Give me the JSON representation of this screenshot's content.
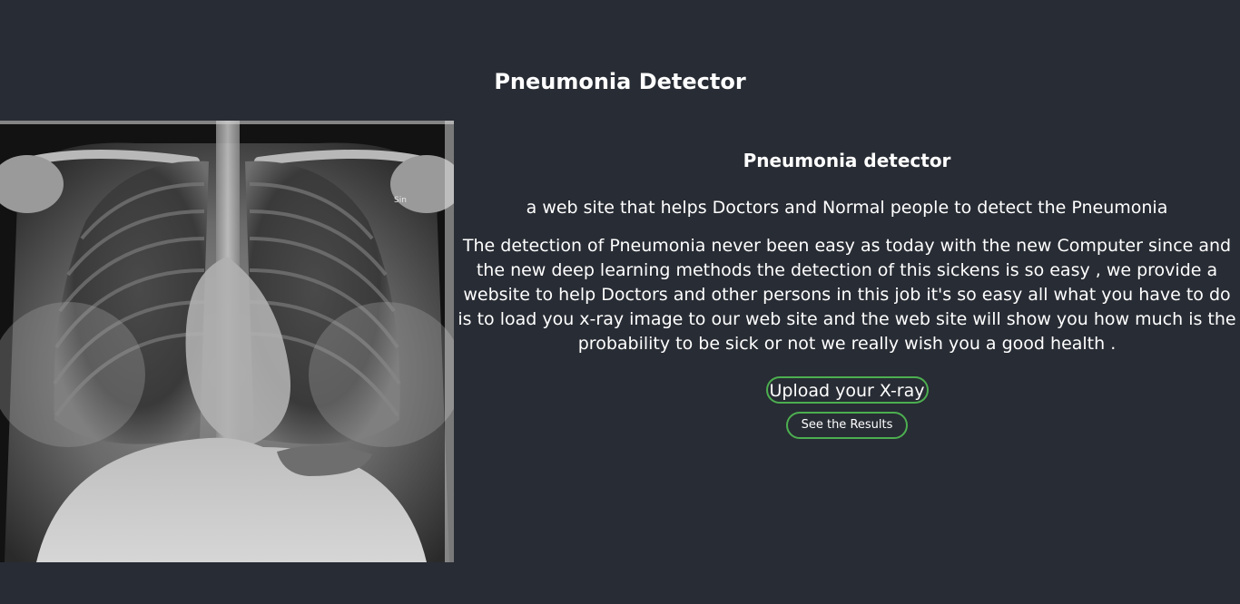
{
  "page": {
    "title": "Pneumonia Detector"
  },
  "hero_image": {
    "icon": "chest-xray-image",
    "marker_text": "Sin"
  },
  "main": {
    "section_title": "Pneumonia detector",
    "subtitle": "a web site that helps Doctors and Normal people to detect the Pneumonia",
    "description": "The detection of Pneumonia never been easy as today with the new Computer since and the new deep learning methods the detection of this sickens is so easy , we provide a website to help Doctors and other persons in this job it's so easy all what you have to do is to load you x-ray image to our web site and the web site will show you how much is the probability to be sick or not we really wish you a good health ."
  },
  "actions": {
    "upload_label": "Upload your X-ray",
    "results_label": "See the Results"
  },
  "colors": {
    "background": "#282c34",
    "text": "#ffffff",
    "button_border": "#4caf50"
  }
}
